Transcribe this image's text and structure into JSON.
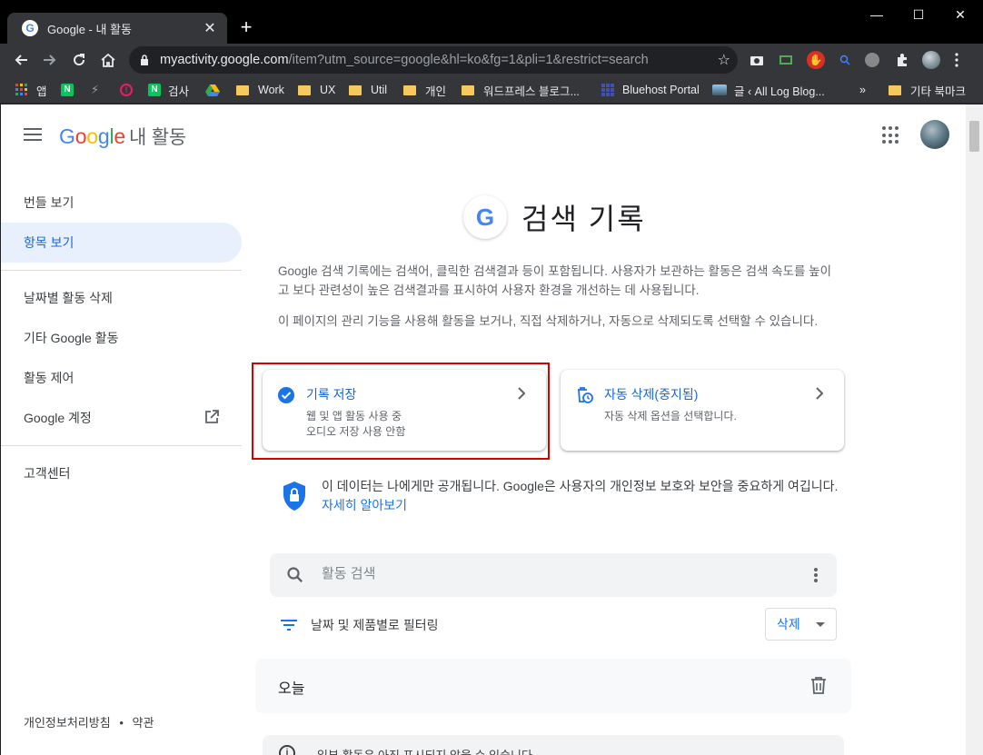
{
  "browser": {
    "tab_title": "Google - 내 활동",
    "tab_close": "✕",
    "new_tab": "+",
    "url_host": "myactivity.google.com",
    "url_path": "/item?utm_source=google&hl=ko&fg=1&pli=1&restrict=search",
    "window_controls": {
      "minimize": "—",
      "maximize": "☐",
      "close": "✕"
    },
    "bookmarks": [
      {
        "label": "앱",
        "icon": "apps-grid-icon"
      },
      {
        "label": "검사",
        "icon": "naver-icon"
      },
      {
        "label": "Work",
        "icon": "folder-icon"
      },
      {
        "label": "UX",
        "icon": "folder-icon"
      },
      {
        "label": "Util",
        "icon": "folder-icon"
      },
      {
        "label": "개인",
        "icon": "folder-icon"
      },
      {
        "label": "워드프레스 블로그...",
        "icon": "folder-icon"
      },
      {
        "label": "Bluehost Portal",
        "icon": "bluehost-icon"
      },
      {
        "label": "글 ‹ All Log Blog...",
        "icon": "blog-icon"
      },
      {
        "label": "»",
        "icon": ""
      },
      {
        "label": "기타 북마크",
        "icon": "folder-icon"
      }
    ]
  },
  "header": {
    "logo_google": "Google",
    "logo_sub": "내 활동"
  },
  "sidebar": {
    "items": [
      {
        "label": "번들 보기"
      },
      {
        "label": "항목 보기",
        "active": true
      },
      {
        "label": "날짜별 활동 삭제"
      },
      {
        "label": "기타 Google 활동"
      },
      {
        "label": "활동 제어"
      },
      {
        "label": "Google 계정",
        "icon": "open-in-new-icon"
      },
      {
        "label": "고객센터"
      }
    ],
    "footer_privacy": "개인정보처리방침",
    "footer_sep": "•",
    "footer_terms": "약관"
  },
  "main": {
    "title": "검색 기록",
    "description1": "Google 검색 기록에는 검색어, 클릭한 검색결과 등이 포함됩니다. 사용자가 보관하는 활동은 검색 속도를 높이고 보다 관련성이 높은 검색결과를 표시하여 사용자 환경을 개선하는 데 사용됩니다.",
    "description2": "이 페이지의 관리 기능을 사용해 활동을 보거나, 직접 삭제하거나, 자동으로 삭제되도록 선택할 수 있습니다.",
    "card_history": {
      "title": "기록 저장",
      "line1": "웹 및 앱 활동 사용 중",
      "line2": "오디오 저장 사용 안함"
    },
    "card_autodelete": {
      "title": "자동 삭제(중지됨)",
      "line1": "자동 삭제 옵션을 선택합니다."
    },
    "privacy_text": "이 데이터는 나에게만 공개됩니다. Google은 사용자의 개인정보 보호와 보안을 중요하게 여깁니다. ",
    "privacy_link": "자세히 알아보기",
    "search_placeholder": "활동 검색",
    "filter_label": "날짜 및 제품별로 필터링",
    "delete_button": "삭제",
    "day_label": "오늘",
    "notice_text": "일부 활동은 아직 표시되지 않을 수 있습니다"
  },
  "colors": {
    "accent": "#1a73e8",
    "active_bg": "#e8f0fe",
    "highlight_box": "#d50000",
    "chrome_dark": "#35363a"
  }
}
